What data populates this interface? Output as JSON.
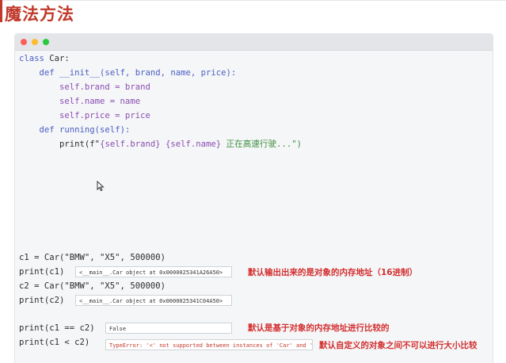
{
  "slide": {
    "title": "魔法方法"
  },
  "code": {
    "line1": {
      "kw": "class",
      "name": " Car:"
    },
    "line2": {
      "indent": "    ",
      "kw": "def",
      "name": " __init__(self, brand, name, price):"
    },
    "line3": "        self.brand = brand",
    "line4": "        self.name = name",
    "line5": "        self.price = price",
    "line6": {
      "indent": "    ",
      "kw": "def",
      "name": " running(self):"
    },
    "line7": {
      "pre": "        print(f\"",
      "a": "{self.brand}",
      "b": " ",
      "c": "{self.name}",
      "d": " 正在高速行驶...\")"
    },
    "c1_assign": "c1 = Car(\"BMW\", \"X5\", 500000)",
    "print_c1": "print(c1)",
    "c2_assign": "c2 = Car(\"BMW\", \"X5\", 500000)",
    "print_c2": "print(c2)",
    "print_eq": "print(c1 == c2)",
    "print_lt": "print(c1 < c2)"
  },
  "outputs": {
    "c1": "<__main__.Car object at 0x0000025341A26A50>",
    "c2": "<__main__.Car object at 0x0000025341C04A50>",
    "eq": "False",
    "lt": "TypeError: '<' not supported between instances of 'Car' and 'Car'"
  },
  "notes": {
    "default_output": "默认输出出来的是对象的内存地址（16进制）",
    "default_compare": "默认是基于对象的内存地址进行比较的",
    "no_size_compare": "默认自定义的对象之间不可以进行大小比较"
  },
  "colors": {
    "accent": "#c0392b",
    "note": "#d32f2f",
    "keyword": "#4a5fc1",
    "string": "#3e8f3e"
  },
  "icons": [
    "traffic-light-red",
    "traffic-light-yellow",
    "traffic-light-green",
    "mouse-cursor-icon"
  ]
}
